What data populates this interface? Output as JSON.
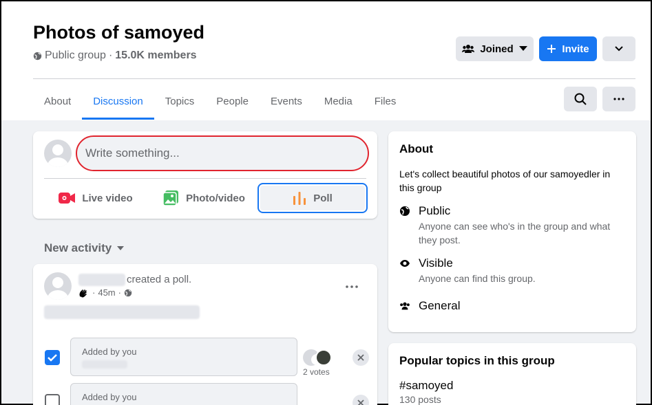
{
  "group": {
    "title": "Photos of samoyed",
    "privacy": "Public group",
    "members": "15.0K members"
  },
  "actions": {
    "joined": "Joined",
    "invite": "Invite"
  },
  "tabs": [
    {
      "label": "About"
    },
    {
      "label": "Discussion"
    },
    {
      "label": "Topics"
    },
    {
      "label": "People"
    },
    {
      "label": "Events"
    },
    {
      "label": "Media"
    },
    {
      "label": "Files"
    }
  ],
  "composer": {
    "placeholder": "Write something...",
    "live": "Live video",
    "photo": "Photo/video",
    "poll": "Poll"
  },
  "feed": {
    "sort": "New activity"
  },
  "post": {
    "action": "created a poll.",
    "time": "45m",
    "options": [
      {
        "by": "Added by you",
        "checked": true
      },
      {
        "by": "Added by you",
        "checked": false
      }
    ],
    "votes": "2 votes"
  },
  "about": {
    "title": "About",
    "description": "Let's collect beautiful photos of our samoyedler in this group",
    "items": [
      {
        "title": "Public",
        "desc": "Anyone can see who's in the group and what they post."
      },
      {
        "title": "Visible",
        "desc": "Anyone can find this group."
      },
      {
        "title": "General",
        "desc": ""
      }
    ]
  },
  "topics": {
    "title": "Popular topics in this group",
    "name": "#samoyed",
    "count": "130 posts"
  },
  "colors": {
    "accent": "#1877f2",
    "highlight": "#e0242e"
  }
}
